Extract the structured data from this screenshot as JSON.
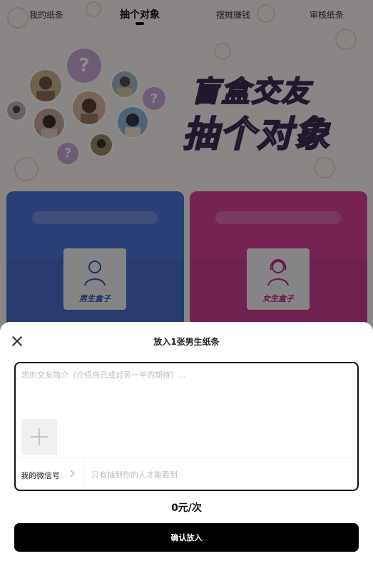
{
  "tabs": [
    {
      "label": "我的纸条",
      "active": false
    },
    {
      "label": "抽个对象",
      "active": true
    },
    {
      "label": "摆摊赚钱",
      "active": false
    },
    {
      "label": "审核纸条",
      "active": false
    }
  ],
  "hero": {
    "line1": "盲盒交友",
    "line2": "抽个对象",
    "question_mark": "?"
  },
  "boxes": {
    "male": {
      "label": "男生盒子",
      "color": "#4c73d6"
    },
    "female": {
      "label": "女生盒子",
      "color": "#d8419a"
    }
  },
  "sheet": {
    "title": "放入1张男生纸条",
    "intro_placeholder": "您的交友简介（介绍自己或对另一半的期待）...",
    "intro_value": "",
    "wechat_label": "我的微信号",
    "wechat_placeholder": "只有抽到你的人才能看到",
    "wechat_value": "",
    "price": "0元/次",
    "confirm_label": "确认放入"
  },
  "icons": [
    "close-icon",
    "add-photo-icon",
    "chevron-right-icon"
  ]
}
